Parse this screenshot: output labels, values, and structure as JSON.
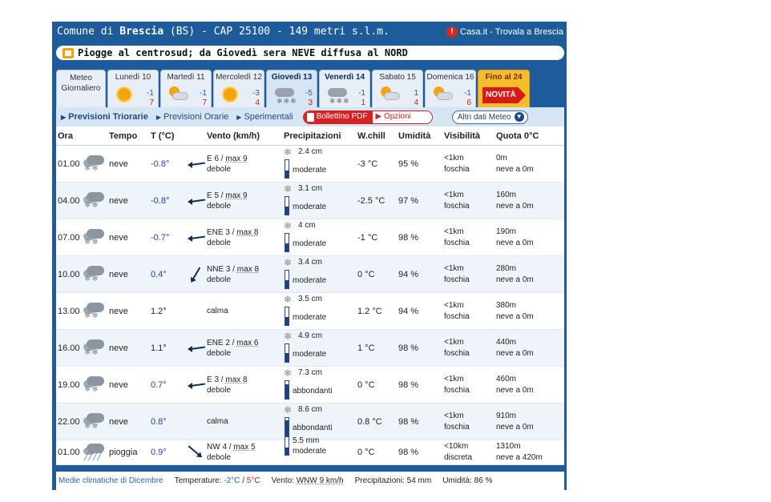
{
  "topbar": {
    "title_prefix": "Comune di",
    "city": "Brescia",
    "title_suffix": "(BS) - CAP 25100 - 149 metri s.l.m.",
    "casa_link": "Casa.it - Trovala a Brescia"
  },
  "headline": "Piogge al centrosud; da Giovedì sera NEVE diffusa al NORD",
  "tabs": {
    "meteo": "Meteo Giornaliero",
    "days": [
      {
        "label": "Lunedì 10",
        "icon": "sun-icon",
        "min": "-1",
        "max": "7"
      },
      {
        "label": "Martedì 11",
        "icon": "sun-cloud-icon",
        "min": "-1",
        "max": "7"
      },
      {
        "label": "Mercoledì 12",
        "icon": "sun-icon",
        "min": "-3",
        "max": "4"
      },
      {
        "label": "Giovedì 13",
        "icon": "snow-icon",
        "min": "-5",
        "max": "3",
        "active": true
      },
      {
        "label": "Venerdì 14",
        "icon": "snow-icon",
        "min": "-1",
        "max": "1"
      },
      {
        "label": "Sabato 15",
        "icon": "sun-cloud-icon",
        "min": "1",
        "max": "4"
      },
      {
        "label": "Domenica 16",
        "icon": "sun-cloud-icon",
        "min": "-1",
        "max": "6"
      }
    ],
    "fino": "Fino al 24",
    "novita": "NOVITÀ"
  },
  "toolbar": {
    "triorarie": "Previsioni Triorarie",
    "orarie": "Previsioni Orarie",
    "sperimentali": "Sperimentali",
    "pdf": "Bollettino PDF",
    "opzioni": "Opzioni",
    "altri": "Altri dati Meteo"
  },
  "headers": {
    "ora": "Ora",
    "tempo": "Tempo",
    "t": "T (°C)",
    "vento": "Vento (km/h)",
    "prec": "Precipitazioni",
    "wc": "W.chill",
    "um": "Umidità",
    "vis": "Visibilità",
    "quota": "Quota 0°C"
  },
  "rows": [
    {
      "ora": "01.00",
      "tempo": "neve",
      "t": "-0.8°",
      "dir": "E 6",
      "max": "max 9",
      "forza": "debole",
      "amt": "2.4 cm",
      "prec": "moderate",
      "fill": 0.4,
      "wc": "-3 °C",
      "um": "95 %",
      "vis": "<1km",
      "vis2": "foschia",
      "q": "0m",
      "q2": "neve a 0m"
    },
    {
      "ora": "04.00",
      "tempo": "neve",
      "t": "-0.8°",
      "dir": "E 5",
      "max": "max 9",
      "forza": "debole",
      "amt": "3.1 cm",
      "prec": "moderate",
      "fill": 0.45,
      "wc": "-2.5 °C",
      "um": "97 %",
      "vis": "<1km",
      "vis2": "foschia",
      "q": "160m",
      "q2": "neve a 0m"
    },
    {
      "ora": "07.00",
      "tempo": "neve",
      "t": "-0.7°",
      "dir": "ENE 3",
      "max": "max 8",
      "forza": "debole",
      "amt": "4 cm",
      "prec": "moderate",
      "fill": 0.45,
      "wc": "-1 °C",
      "um": "98 %",
      "vis": "<1km",
      "vis2": "foschia",
      "q": "190m",
      "q2": "neve a 0m"
    },
    {
      "ora": "10.00",
      "tempo": "neve",
      "t": "0.4°",
      "dir": "NNE 3",
      "max": "max 8",
      "forza": "debole",
      "amt": "3.4 cm",
      "prec": "moderate",
      "fill": 0.45,
      "wc": "0 °C",
      "um": "94 %",
      "vis": "<1km",
      "vis2": "foschia",
      "q": "280m",
      "q2": "neve a 0m"
    },
    {
      "ora": "13.00",
      "tempo": "neve",
      "t": "1.2°",
      "dir": "calma",
      "max": "",
      "forza": "",
      "amt": "3.5 cm",
      "prec": "moderate",
      "fill": 0.45,
      "wc": "1.2 °C",
      "um": "94 %",
      "vis": "<1km",
      "vis2": "foschia",
      "q": "380m",
      "q2": "neve a 0m"
    },
    {
      "ora": "16.00",
      "tempo": "neve",
      "t": "1.1°",
      "dir": "ENE 2",
      "max": "max 6",
      "forza": "debole",
      "amt": "4.9 cm",
      "prec": "moderate",
      "fill": 0.5,
      "wc": "1 °C",
      "um": "98 %",
      "vis": "<1km",
      "vis2": "foschia",
      "q": "440m",
      "q2": "neve a 0m"
    },
    {
      "ora": "19.00",
      "tempo": "neve",
      "t": "0.7°",
      "dir": "E 3",
      "max": "max 8",
      "forza": "debole",
      "amt": "7.3 cm",
      "prec": "abbondanti",
      "fill": 0.8,
      "wc": "0 °C",
      "um": "98 %",
      "vis": "<1km",
      "vis2": "foschia",
      "q": "460m",
      "q2": "neve a 0m"
    },
    {
      "ora": "22.00",
      "tempo": "neve",
      "t": "0.8°",
      "dir": "calma",
      "max": "",
      "forza": "",
      "amt": "8.6 cm",
      "prec": "abbondanti",
      "fill": 0.85,
      "wc": "0.8 °C",
      "um": "98 %",
      "vis": "<1km",
      "vis2": "foschia",
      "q": "910m",
      "q2": "neve a 0m"
    },
    {
      "ora": "01.00",
      "tempo": "pioggia",
      "t": "0.9°",
      "dir": "NW 4",
      "max": "max 5",
      "forza": "debole",
      "amt": "5.5 mm",
      "prec": "moderate",
      "fill": 0.4,
      "wc": "0 °C",
      "um": "98 %",
      "vis": "<10km",
      "vis2": "discreta",
      "q": "1310m",
      "q2": "neve a 420m"
    }
  ],
  "footer": {
    "medie": "Medie climatiche di Dicembre",
    "temp_label": "Temperature:",
    "tmin": "-2°C",
    "sep": "/",
    "tmax": "5°C",
    "vento_label": "Vento:",
    "vento": "WNW 9 km/h",
    "prec": "Precipitazioni: 54 mm",
    "umid": "Umidità: 86 %"
  }
}
